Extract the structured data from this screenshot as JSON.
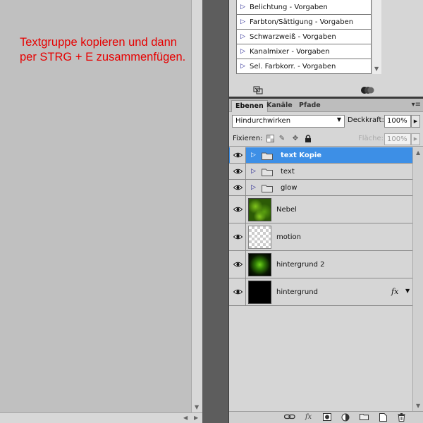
{
  "annotation": {
    "text": "Textgruppe kopieren und dann per STRG + E zusammenfügen."
  },
  "presets": {
    "items": [
      {
        "label": "Belichtung - Vorgaben"
      },
      {
        "label": "Farbton/Sättigung - Vorgaben"
      },
      {
        "label": "Schwarzweiß - Vorgaben"
      },
      {
        "label": "Kanalmixer - Vorgaben"
      },
      {
        "label": "Sel. Farbkorr. - Vorgaben"
      }
    ]
  },
  "layers_panel": {
    "tabs": [
      {
        "label": "Ebenen",
        "active": true
      },
      {
        "label": "Kanäle",
        "active": false
      },
      {
        "label": "Pfade",
        "active": false
      }
    ],
    "blend_mode": "Hindurchwirken",
    "opacity_label": "Deckkraft:",
    "opacity_value": "100%",
    "lock_label": "Fixieren:",
    "fill_label": "Fläche:",
    "fill_value": "100%",
    "layers": [
      {
        "name": "text Kopie",
        "kind": "group",
        "selected": true
      },
      {
        "name": "text",
        "kind": "group",
        "selected": false
      },
      {
        "name": "glow",
        "kind": "group",
        "selected": false
      },
      {
        "name": "Nebel",
        "kind": "layer",
        "thumbnail": "green-clouds",
        "selected": false
      },
      {
        "name": "motion",
        "kind": "layer",
        "thumbnail": "transparent",
        "selected": false
      },
      {
        "name": "hintergrund 2",
        "kind": "layer",
        "thumbnail": "green-glow",
        "selected": false
      },
      {
        "name": "hintergrund",
        "kind": "layer",
        "thumbnail": "black",
        "has_effects": true,
        "fx_label": "fx",
        "selected": false
      }
    ]
  },
  "colors": {
    "annotation": "#e60000",
    "selection": "#3d8fe6"
  }
}
